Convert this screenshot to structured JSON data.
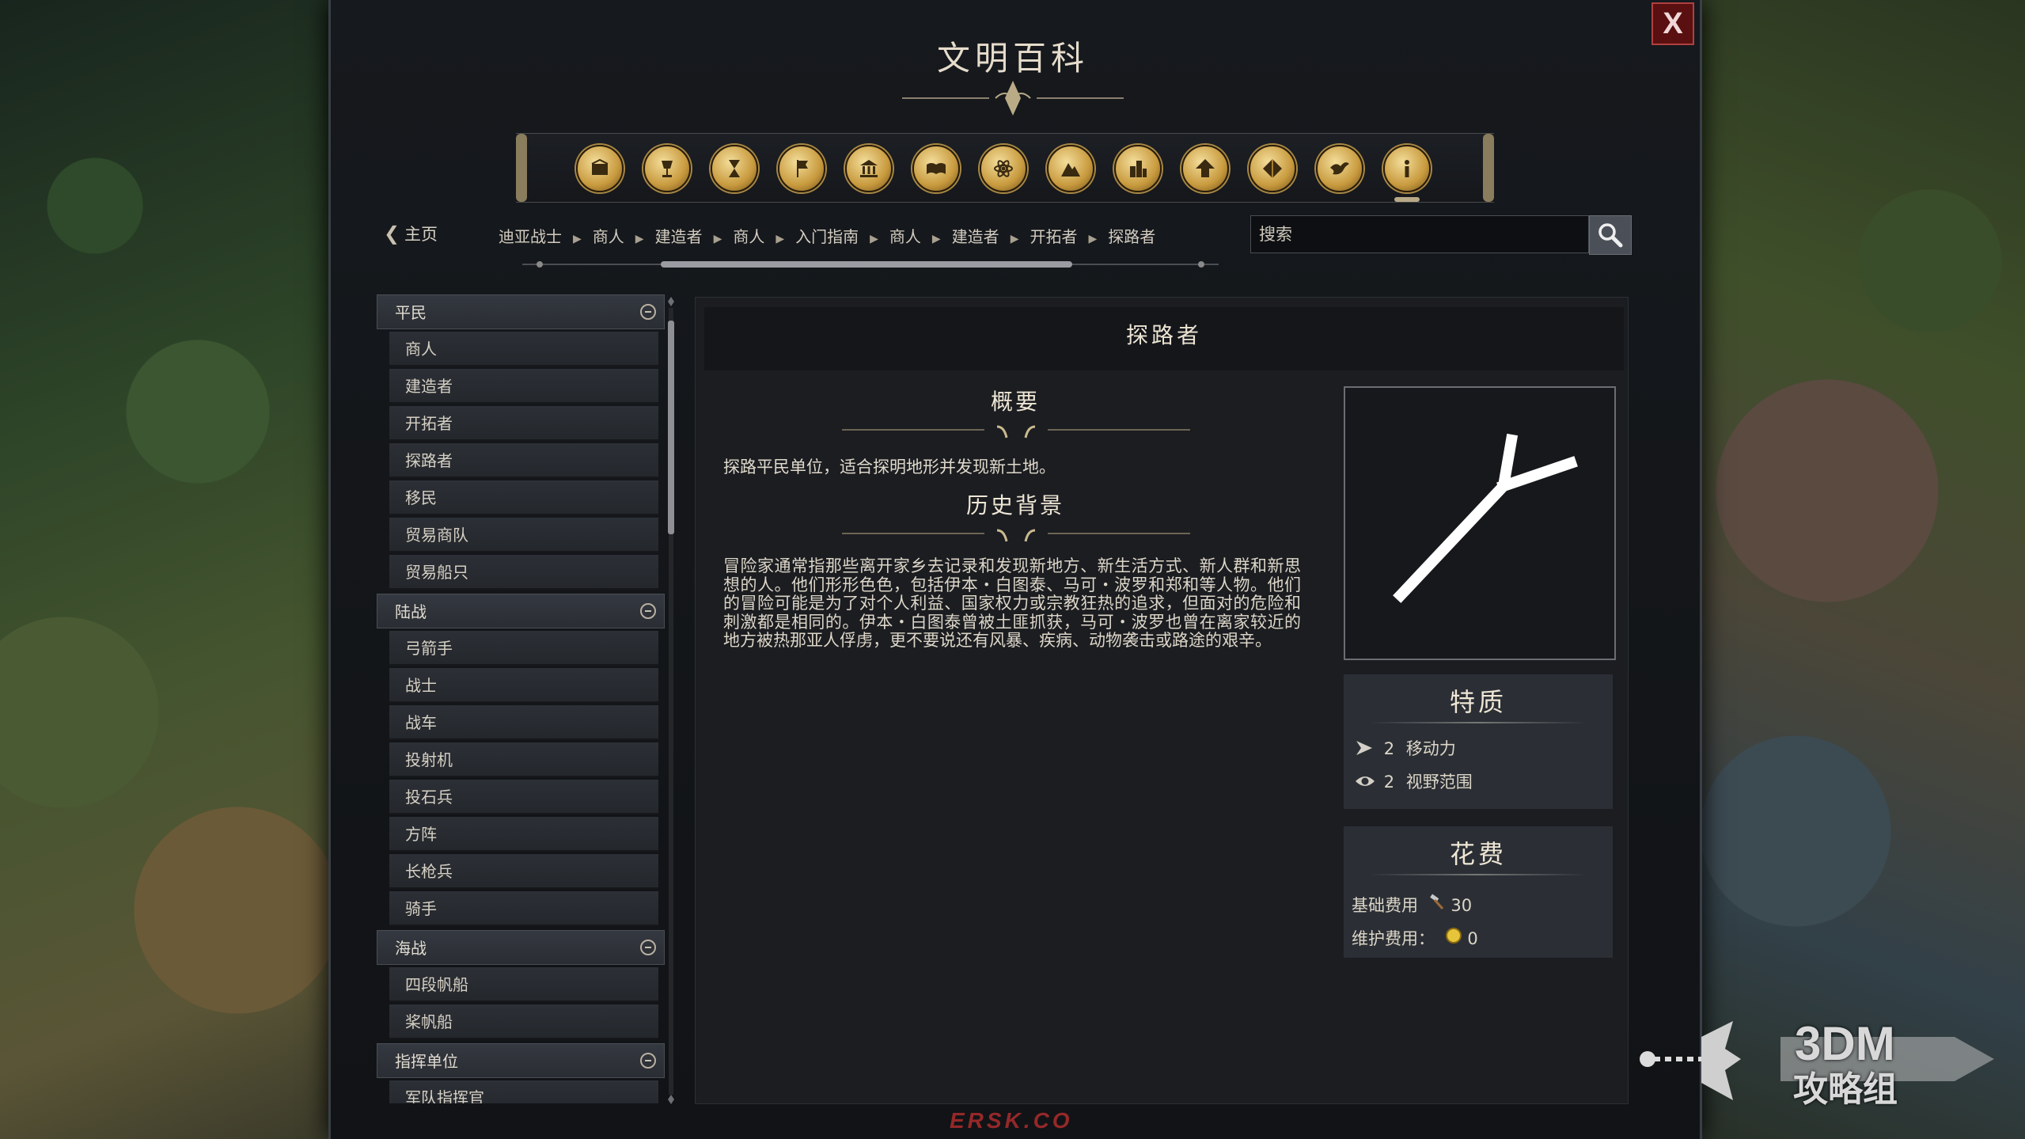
{
  "window": {
    "title": "文明百科",
    "close_label": "X"
  },
  "toolbar": {
    "icons": [
      "crate-icon",
      "chalice-icon",
      "hourglass-icon",
      "flag-icon",
      "building-icon",
      "book-icon",
      "atom-icon",
      "mountain-icon",
      "city-icon",
      "arrow-up-icon",
      "cube-icon",
      "dove-icon",
      "info-icon"
    ],
    "selected_index": 12
  },
  "nav": {
    "home_label": "主页",
    "breadcrumbs": [
      "迪亚战士",
      "商人",
      "建造者",
      "商人",
      "入门指南",
      "商人",
      "建造者",
      "开拓者",
      "探路者"
    ]
  },
  "search": {
    "placeholder": "搜索"
  },
  "sidebar": {
    "categories": [
      {
        "label": "平民",
        "items": [
          "商人",
          "建造者",
          "开拓者",
          "探路者",
          "移民",
          "贸易商队",
          "贸易船只"
        ]
      },
      {
        "label": "陆战",
        "items": [
          "弓箭手",
          "战士",
          "战车",
          "投射机",
          "投石兵",
          "方阵",
          "长枪兵",
          "骑手"
        ]
      },
      {
        "label": "海战",
        "items": [
          "四段帆船",
          "桨帆船"
        ]
      },
      {
        "label": "指挥单位",
        "items": [
          "军队指挥官"
        ]
      }
    ]
  },
  "article": {
    "title": "探路者",
    "summary_heading": "概要",
    "summary": "探路平民单位，适合探明地形并发现新土地。",
    "history_heading": "历史背景",
    "history": "冒险家通常指那些离开家乡去记录和发现新地方、新生活方式、新人群和新思想的人。他们形形色色，包括伊本・白图泰、马可・波罗和郑和等人物。他们的冒险可能是为了对个人利益、国家权力或宗教狂热的追求，但面对的危险和刺激都是相同的。伊本・白图泰曾被土匪抓获，马可・波罗也曾在离家较近的地方被热那亚人俘虏，更不要说还有风暴、疾病、动物袭击或路途的艰辛。",
    "traits_heading": "特质",
    "traits": [
      {
        "icon": "movement-arrow-icon",
        "value": "2",
        "label": "移动力"
      },
      {
        "icon": "eye-icon",
        "value": "2",
        "label": "视野范围"
      }
    ],
    "cost_heading": "花费",
    "costs": [
      {
        "label": "基础费用",
        "icon": "hammer-icon",
        "value": "30"
      },
      {
        "label": "维护费用：",
        "icon": "gold-coin-icon",
        "value": "0"
      }
    ]
  },
  "watermarks": {
    "brand": "3DM",
    "sub": "攻略组",
    "bottom": "ERSK.CO"
  },
  "colors": {
    "accent_gold": "#c89a3e",
    "close_red": "#5a1010",
    "panel_bg": "#16191d"
  }
}
